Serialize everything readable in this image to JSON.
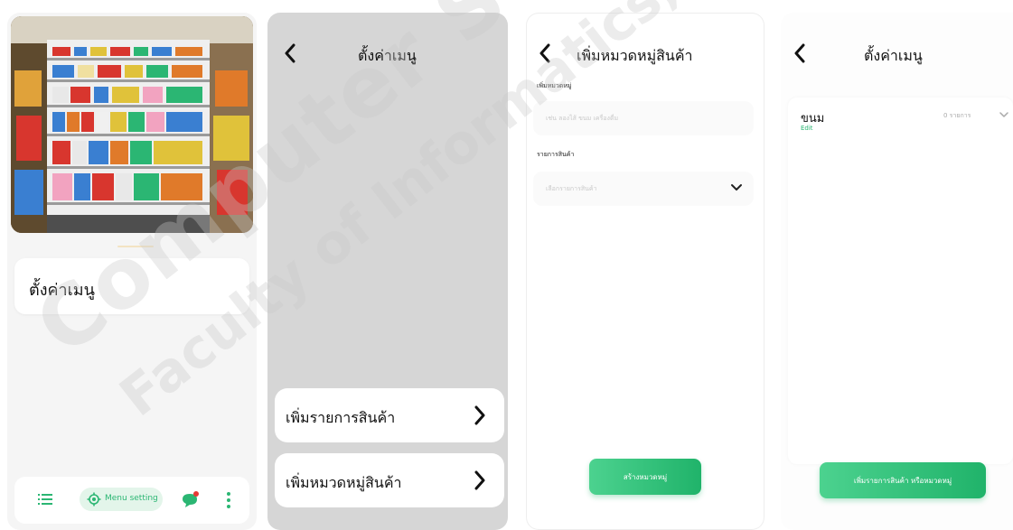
{
  "panel1": {
    "menu_card_label": "ตั้งค่าเมนู",
    "tabbar": {
      "list_icon": "list-icon",
      "active_tab_icon": "gear-icon",
      "active_tab_label": "Menu setting",
      "chat_icon": "chat-bubble-icon",
      "more_icon": "more-vertical-icon"
    }
  },
  "panel2": {
    "title": "ตั้งค่าเมนู",
    "items": [
      {
        "label": "เพิ่มรายการสินค้า"
      },
      {
        "label": "เพิ่มหมวดหมู่สินค้า"
      }
    ]
  },
  "panel3": {
    "title": "เพิ่มหมวดหมู่สินค้า",
    "category_label": "เพิ่มหมวดหมู่",
    "category_placeholder": "เช่น ลองไส้ ขนม เครื่องดื่ม",
    "products_label": "รายการสินค้า",
    "products_placeholder": "เลือกรายการสินค้า",
    "create_button": "สร้างหมวดหมู่"
  },
  "panel4": {
    "title": "ตั้งค่าเมนู",
    "category": {
      "name": "ขนม",
      "edit": "Edit",
      "count": "0 รายการ"
    },
    "add_button": "เพิ่มรายการสินค้า หรือหมวดหมู่"
  },
  "watermark": {
    "line1": "Computer Science, Mahasarakham",
    "line2": "Faculty of Informatics,"
  },
  "colors": {
    "accent": "#2bb673",
    "button_start": "#4cd28f",
    "button_end": "#20b36a",
    "panel2_bg": "#d6d6d6",
    "notification": "#e53935"
  }
}
